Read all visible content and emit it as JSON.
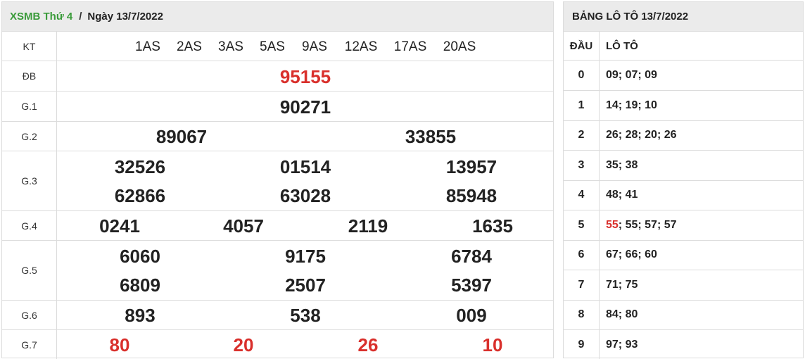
{
  "header": {
    "link": "XSMB Thứ 4",
    "separator": "/",
    "date": "Ngày 13/7/2022"
  },
  "kt": {
    "label": "KT",
    "items": [
      "1AS",
      "2AS",
      "3AS",
      "5AS",
      "9AS",
      "12AS",
      "17AS",
      "20AS"
    ]
  },
  "prizes": {
    "db": {
      "label": "ĐB",
      "values": [
        "95155"
      ]
    },
    "g1": {
      "label": "G.1",
      "values": [
        "90271"
      ]
    },
    "g2": {
      "label": "G.2",
      "values": [
        "89067",
        "33855"
      ]
    },
    "g3": {
      "label": "G.3",
      "values": [
        "32526",
        "01514",
        "13957",
        "62866",
        "63028",
        "85948"
      ]
    },
    "g4": {
      "label": "G.4",
      "values": [
        "0241",
        "4057",
        "2119",
        "1635"
      ]
    },
    "g5": {
      "label": "G.5",
      "values": [
        "6060",
        "9175",
        "6784",
        "6809",
        "2507",
        "5397"
      ]
    },
    "g6": {
      "label": "G.6",
      "values": [
        "893",
        "538",
        "009"
      ]
    },
    "g7": {
      "label": "G.7",
      "values": [
        "80",
        "20",
        "26",
        "10"
      ]
    }
  },
  "loto": {
    "title": "BẢNG LÔ TÔ 13/7/2022",
    "col_dau": "ĐẦU",
    "col_loto": "LÔ TÔ",
    "rows": [
      {
        "dau": "0",
        "pre": "",
        "red": "",
        "rest": "09; 07; 09"
      },
      {
        "dau": "1",
        "pre": "",
        "red": "",
        "rest": "14; 19; 10"
      },
      {
        "dau": "2",
        "pre": "",
        "red": "",
        "rest": "26; 28; 20; 26"
      },
      {
        "dau": "3",
        "pre": "",
        "red": "",
        "rest": "35; 38"
      },
      {
        "dau": "4",
        "pre": "",
        "red": "",
        "rest": "48; 41"
      },
      {
        "dau": "5",
        "pre": "",
        "red": "55",
        "rest": "; 55; 57; 57"
      },
      {
        "dau": "6",
        "pre": "",
        "red": "",
        "rest": "67; 66; 60"
      },
      {
        "dau": "7",
        "pre": "",
        "red": "",
        "rest": "71; 75"
      },
      {
        "dau": "8",
        "pre": "",
        "red": "",
        "rest": "84; 80"
      },
      {
        "dau": "9",
        "pre": "",
        "red": "",
        "rest": "97; 93"
      }
    ]
  },
  "colors": {
    "accent_green": "#3a9b3a",
    "highlight_red": "#d9302c",
    "header_bg": "#ebebeb"
  }
}
